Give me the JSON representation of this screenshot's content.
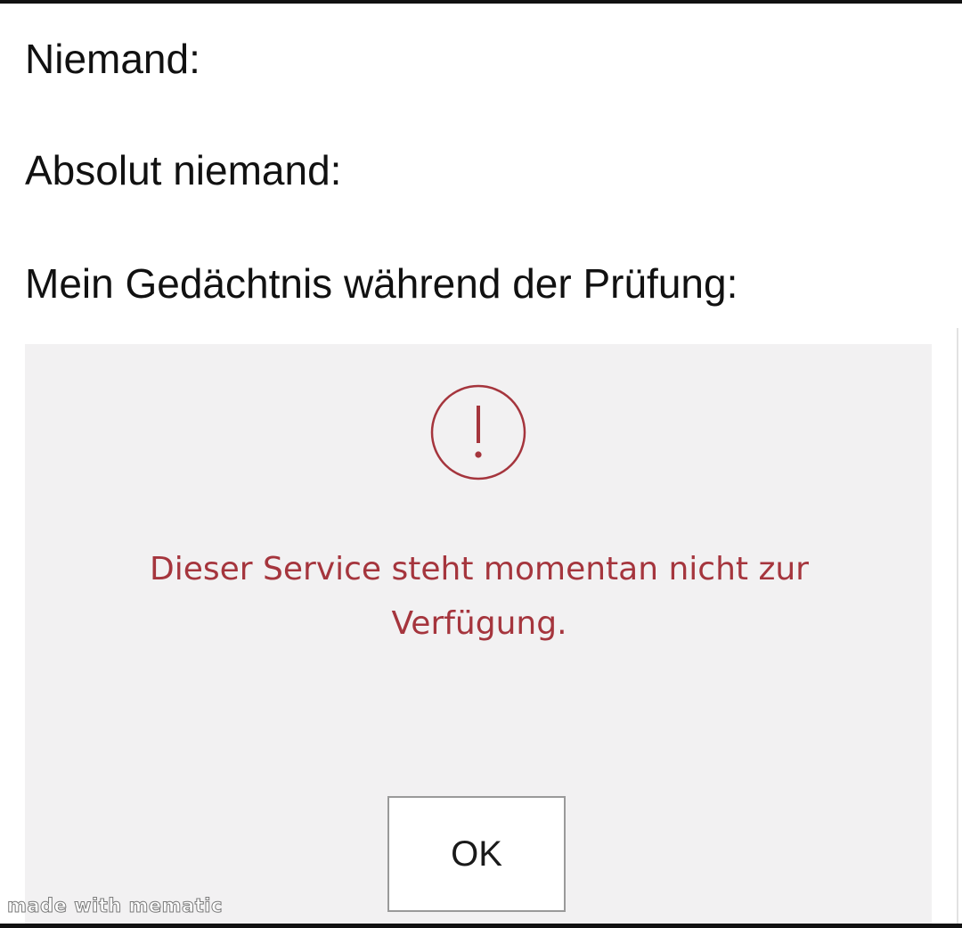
{
  "meme": {
    "lines": [
      "Niemand:",
      "Absolut niemand:",
      "Mein Gedächtnis während der Prüfung:"
    ]
  },
  "dialog": {
    "icon": "exclamation-circle-icon",
    "message": "Dieser Service steht momentan nicht zur Verfügung.",
    "ok_label": "OK",
    "accent_color": "#a5353d",
    "background_color": "#f2f1f2"
  },
  "watermark": {
    "text": "made with mematic"
  }
}
